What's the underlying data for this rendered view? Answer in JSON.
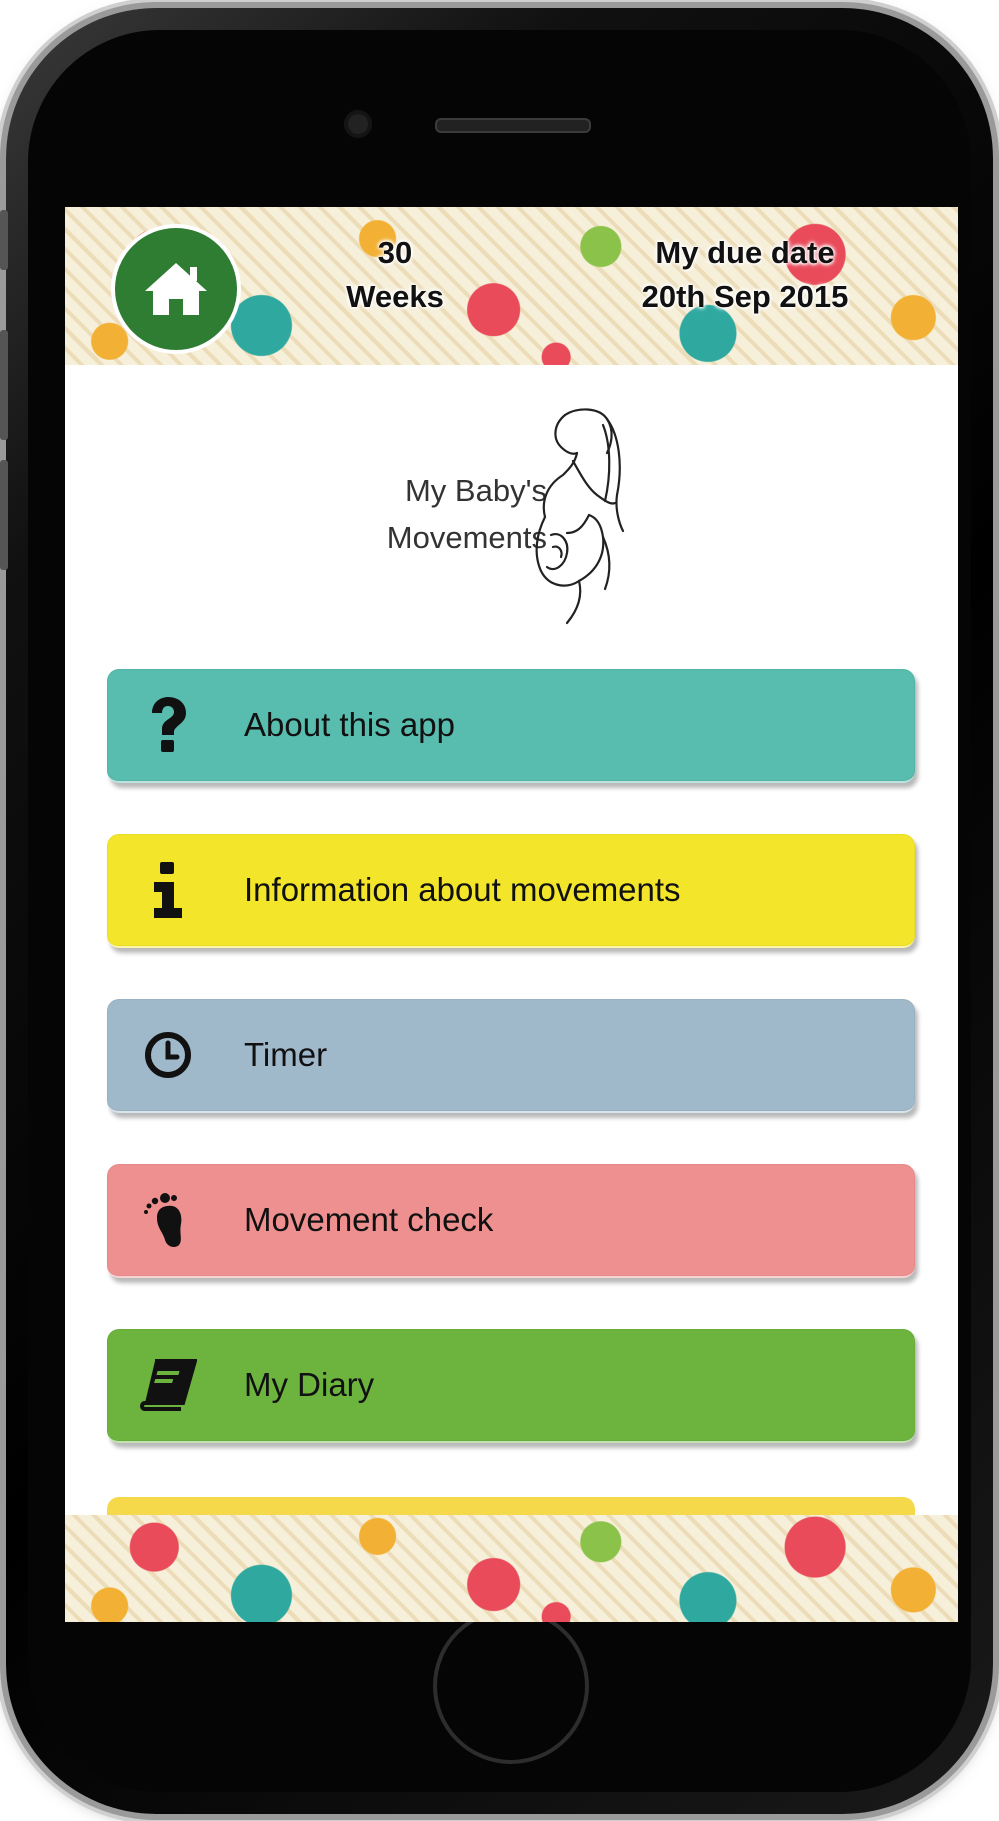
{
  "header": {
    "home_icon": "home-icon",
    "weeks_number": "30",
    "weeks_label": "Weeks",
    "due_label": "My due date",
    "due_date": "20th Sep 2015"
  },
  "title": {
    "line1": "My Baby's",
    "line2": "Movements",
    "illustration": "pregnant-woman-illustration"
  },
  "menu": [
    {
      "label": "About this app",
      "icon": "question-icon",
      "color": "#58bcae"
    },
    {
      "label": "Information about movements",
      "icon": "info-icon",
      "color": "#f3e62a"
    },
    {
      "label": "Timer",
      "icon": "clock-icon",
      "color": "#9fb9cb"
    },
    {
      "label": "Movement check",
      "icon": "footprint-icon",
      "color": "#ee9090"
    },
    {
      "label": "My Diary",
      "icon": "book-icon",
      "color": "#6db43f"
    }
  ]
}
